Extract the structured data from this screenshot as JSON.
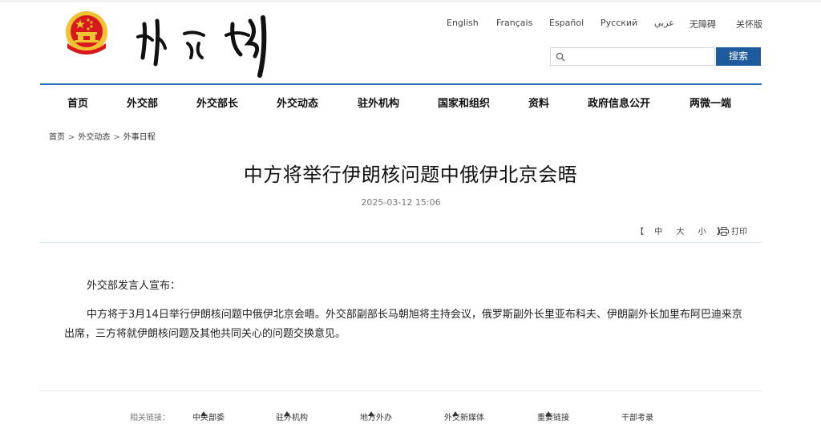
{
  "header": {
    "site_logo_text": "外交部"
  },
  "languages": [
    "English",
    "Français",
    "Español",
    "Русский",
    "عربي",
    "无障碍",
    "关怀版"
  ],
  "search": {
    "placeholder": "",
    "button_label": "搜索"
  },
  "nav": {
    "items": [
      "首页",
      "外交部",
      "外交部长",
      "外交动态",
      "驻外机构",
      "国家和组织",
      "资料",
      "政府信息公开",
      "两微一端"
    ]
  },
  "breadcrumb": {
    "items": [
      "首页",
      "外交动态",
      "外事日程"
    ],
    "separator": ">"
  },
  "article": {
    "title": "中方将举行伊朗核问题中俄伊北京会晤",
    "date": "2025-03-12 15:06",
    "paragraph1": "外交部发言人宣布：",
    "paragraph2": "中方将于3月14日举行伊朗核问题中俄伊北京会晤。外交部副部长马朝旭将主持会议，俄罗斯副外长里亚布科夫、伊朗副外长加里布阿巴迪来京出席，三方将就伊朗核问题及其他共同关心的问题交换意见。"
  },
  "tools": {
    "bracket_open": "【",
    "sizes": [
      "中",
      "大",
      "小"
    ],
    "bracket_close": "】",
    "print_label": "打印"
  },
  "footer": {
    "label": "相关链接：",
    "links": [
      "中央部委",
      "驻外机构",
      "地方外办",
      "外交新媒体",
      "重要链接",
      "干部考录"
    ]
  },
  "colors": {
    "accent": "#1d5a9e",
    "nav_rule": "#2d6db5",
    "emblem_red": "#d7181f",
    "emblem_gold": "#f0c330"
  },
  "icons": {
    "emblem": "national-emblem-icon",
    "search": "search-icon",
    "print": "printer-icon",
    "dropdown": "triangle-up-icon"
  }
}
